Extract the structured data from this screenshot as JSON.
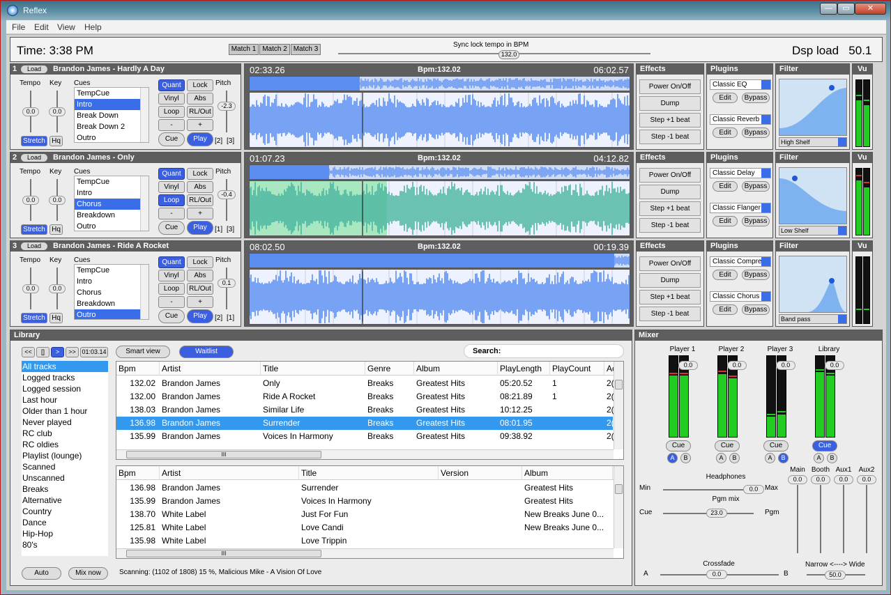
{
  "window": {
    "title": "Reflex",
    "minimize": "—",
    "maximize": "▭",
    "close": "✕"
  },
  "menu": [
    "File",
    "Edit",
    "View",
    "Help"
  ],
  "topbar": {
    "time": "Time: 3:38 PM",
    "match_buttons": [
      "Match 1",
      "Match 2",
      "Match 3"
    ],
    "sync_label": "Sync lock tempo in BPM",
    "sync_value": "132.0",
    "dsp_label": "Dsp load",
    "dsp_value": "50.1"
  },
  "decks": [
    {
      "num": "1",
      "load": "Load",
      "track": "Brandon James - Hardly A Day",
      "tempo_label": "Tempo",
      "key_label": "Key",
      "cues_label": "Cues",
      "pitch_label": "Pitch",
      "tempo": "0.0",
      "key": "0.0",
      "pitch": "-2.3",
      "cues": [
        "TempCue",
        "Intro",
        "Break Down",
        "Break Down 2",
        "Outro"
      ],
      "selected_cue": 1,
      "stretch": "Stretch",
      "hq": "Hq",
      "quant": "Quant",
      "lock": "Lock",
      "vinyl": "Vinyl",
      "abs": "Abs",
      "loop": "Loop",
      "rlout": "RL/Out",
      "minus": "-",
      "plus": "+",
      "cue": "Cue",
      "play": "Play",
      "b1": "[2]",
      "b2": "[3]",
      "loop_on": false,
      "elapsed": "02:33.26",
      "bpm": "Bpm:132.02",
      "remaining": "06:02.57",
      "overview_progress": 0.29,
      "effects_title": "Effects",
      "effects": [
        "Power On/Off",
        "Dump",
        "Step +1 beat",
        "Step -1 beat"
      ],
      "plugins_title": "Plugins",
      "plugins": [
        "Classic EQ",
        "Classic Reverb"
      ],
      "edit": "Edit",
      "bypass": "Bypass",
      "filter_title": "Filter",
      "filter_type": "High Shelf",
      "vu_title": "Vu",
      "vu": [
        0.7,
        0.62
      ]
    },
    {
      "num": "2",
      "load": "Load",
      "track": "Brandon James - Only",
      "tempo_label": "Tempo",
      "key_label": "Key",
      "cues_label": "Cues",
      "pitch_label": "Pitch",
      "tempo": "0.0",
      "key": "0.0",
      "pitch": "-0.4",
      "cues": [
        "TempCue",
        "Intro",
        "Chorus",
        "Breakdown",
        "Outro"
      ],
      "selected_cue": 2,
      "stretch": "Stretch",
      "hq": "Hq",
      "quant": "Quant",
      "lock": "Lock",
      "vinyl": "Vinyl",
      "abs": "Abs",
      "loop": "Loop",
      "rlout": "RL/Out",
      "minus": "-",
      "plus": "+",
      "cue": "Cue",
      "play": "Play",
      "b1": "[1]",
      "b2": "[3]",
      "loop_on": true,
      "elapsed": "01:07.23",
      "bpm": "Bpm:132.02",
      "remaining": "04:12.82",
      "overview_progress": 0.21,
      "effects_title": "Effects",
      "effects": [
        "Power On/Off",
        "Dump",
        "Step +1 beat",
        "Step -1 beat"
      ],
      "plugins_title": "Plugins",
      "plugins": [
        "Classic Delay",
        "Classic Flanger"
      ],
      "edit": "Edit",
      "bypass": "Bypass",
      "filter_title": "Filter",
      "filter_type": "Low Shelf",
      "vu_title": "Vu",
      "vu": [
        0.82,
        0.72
      ]
    },
    {
      "num": "3",
      "load": "Load",
      "track": "Brandon James - Ride A Rocket",
      "tempo_label": "Tempo",
      "key_label": "Key",
      "cues_label": "Cues",
      "pitch_label": "Pitch",
      "tempo": "0.0",
      "key": "0.0",
      "pitch": "0.1",
      "cues": [
        "TempCue",
        "Intro",
        "Chorus",
        "Breakdown",
        "Outro"
      ],
      "selected_cue": 4,
      "stretch": "Stretch",
      "hq": "Hq",
      "quant": "Quant",
      "lock": "Lock",
      "vinyl": "Vinyl",
      "abs": "Abs",
      "loop": "Loop",
      "rlout": "RL/Out",
      "minus": "-",
      "plus": "+",
      "cue": "Cue",
      "play": "Play",
      "b1": "[2]",
      "b2": "[1]",
      "loop_on": false,
      "elapsed": "08:02.50",
      "bpm": "Bpm:132.02",
      "remaining": "00:19.39",
      "overview_progress": 0.96,
      "effects_title": "Effects",
      "effects": [
        "Power On/Off",
        "Dump",
        "Step +1 beat",
        "Step -1 beat"
      ],
      "plugins_title": "Plugins",
      "plugins": [
        "Classic Compre",
        "Classic Chorus"
      ],
      "edit": "Edit",
      "bypass": "Bypass",
      "filter_title": "Filter",
      "filter_type": "Band pass",
      "vu_title": "Vu",
      "vu": [
        0.0,
        0.0
      ]
    }
  ],
  "library": {
    "title": "Library",
    "transport": [
      "<<",
      "[]",
      ">",
      ">>"
    ],
    "position": "01:03.14",
    "smart_view": "Smart view",
    "waitlist": "Waitlist",
    "search_label": "Search:",
    "categories": [
      "All tracks",
      "Logged tracks",
      "Logged session",
      "Last hour",
      "Older than 1 hour",
      "Never played",
      "RC club",
      "RC oldies",
      "Playlist (lounge)",
      "Scanned",
      "Unscanned",
      "Breaks",
      "Alternative",
      "Country",
      "Dance",
      "Hip-Hop",
      "80's"
    ],
    "selected_category": 0,
    "table1_headers": [
      "Bpm",
      "Artist",
      "Title",
      "Genre",
      "Album",
      "PlayLength",
      "PlayCount",
      "Ac"
    ],
    "table1_rows": [
      [
        "132.02",
        "Brandon James",
        "Only",
        "Breaks",
        "Greatest Hits",
        "05:20.52",
        "1",
        "2("
      ],
      [
        "132.00",
        "Brandon James",
        "Ride A Rocket",
        "Breaks",
        "Greatest Hits",
        "08:21.89",
        "1",
        "2("
      ],
      [
        "138.03",
        "Brandon James",
        "Similar Life",
        "Breaks",
        "Greatest Hits",
        "10:12.25",
        "",
        "2("
      ],
      [
        "136.98",
        "Brandon James",
        "Surrender",
        "Breaks",
        "Greatest Hits",
        "08:01.95",
        "",
        "2("
      ],
      [
        "135.99",
        "Brandon James",
        "Voices In Harmony",
        "Breaks",
        "Greatest Hits",
        "09:38.92",
        "",
        "2("
      ]
    ],
    "table1_selected": 3,
    "table2_headers": [
      "Bpm",
      "Artist",
      "Title",
      "Version",
      "Album"
    ],
    "table2_rows": [
      [
        "136.98",
        "Brandon James",
        "Surrender",
        "",
        "Greatest Hits"
      ],
      [
        "135.99",
        "Brandon James",
        "Voices In Harmony",
        "",
        "Greatest Hits"
      ],
      [
        "138.70",
        "White Label",
        "Just For Fun",
        "",
        "New Breaks June 0..."
      ],
      [
        "125.81",
        "White Label",
        "Love Candi",
        "",
        "New Breaks June 0..."
      ],
      [
        "135.98",
        "White Label",
        "Love Trippin",
        "",
        ""
      ]
    ],
    "auto": "Auto",
    "mix_now": "Mix now",
    "status": "Scanning: (1102 of 1808)  15 %, Malicious Mike - A Vision Of Love",
    "scroll_grip": "III"
  },
  "mixer": {
    "title": "Mixer",
    "channels": [
      {
        "name": "Player 1",
        "value": "0.0",
        "cue": "Cue",
        "cue_on": false,
        "a": "A",
        "b": "B",
        "a_on": true,
        "b_on": false,
        "levels": [
          0.76,
          0.76
        ]
      },
      {
        "name": "Player 2",
        "value": "0.0",
        "cue": "Cue",
        "cue_on": false,
        "a": "A",
        "b": "B",
        "a_on": false,
        "b_on": false,
        "levels": [
          0.78,
          0.72
        ]
      },
      {
        "name": "Player 3",
        "value": "0.0",
        "cue": "Cue",
        "cue_on": false,
        "a": "A",
        "b": "B",
        "a_on": false,
        "b_on": true,
        "levels": [
          0.25,
          0.28
        ]
      },
      {
        "name": "Library",
        "value": "0.0",
        "cue": "Cue",
        "cue_on": true,
        "a": "A",
        "b": "B",
        "a_on": false,
        "b_on": false,
        "levels": [
          0.8,
          0.76
        ]
      }
    ],
    "headphones_label": "Headphones",
    "min": "Min",
    "max": "Max",
    "headphones_value": "0.0",
    "pgm_mix_label": "Pgm mix",
    "cue_label": "Cue",
    "pgm_label": "Pgm",
    "pgm_value": "23.0",
    "crossfade_label": "Crossfade",
    "a_label": "A",
    "b_label": "B",
    "crossfade_value": "0.0",
    "narrow_wide": "Narrow <----> Wide",
    "width_value": "50.0",
    "outputs": [
      {
        "name": "Main",
        "value": "0.0"
      },
      {
        "name": "Booth",
        "value": "0.0"
      },
      {
        "name": "Aux1",
        "value": "0.0"
      },
      {
        "name": "Aux2",
        "value": "0.0"
      }
    ]
  },
  "colors": {
    "accent": "#3a6ee8",
    "waveform": "#5b8ef0",
    "vu_green": "#22cc22",
    "selection": "#3399ee"
  }
}
